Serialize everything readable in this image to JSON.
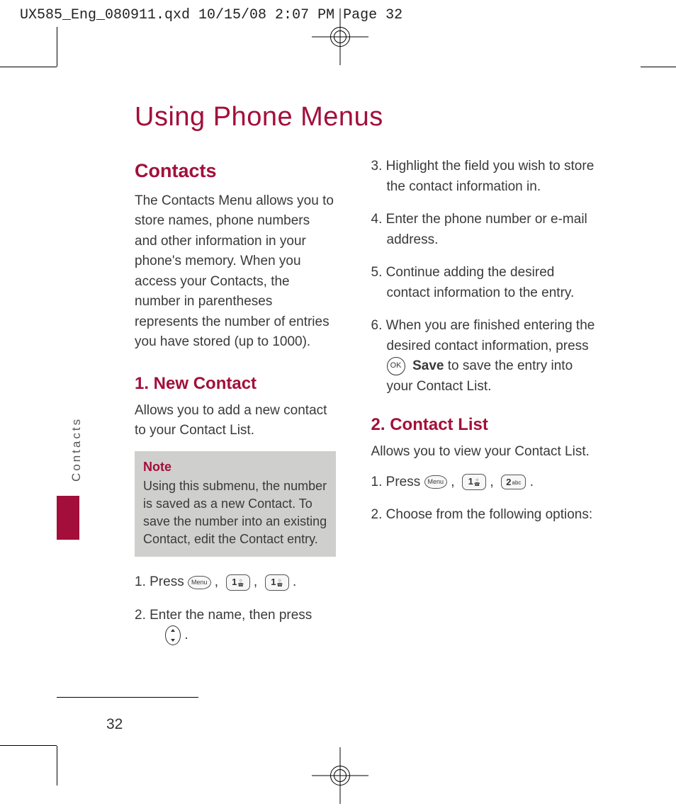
{
  "header_slug": "UX585_Eng_080911.qxd  10/15/08  2:07 PM  Page 32",
  "page_title": "Using Phone Menus",
  "side_tab": "Contacts",
  "page_number": "32",
  "section_contacts": {
    "heading": "Contacts",
    "body": "The Contacts Menu allows you to store names, phone numbers and other information in your phone's memory. When you access your Contacts, the number in parentheses represents the number of entries you have stored (up to 1000)."
  },
  "section_new_contact": {
    "heading": "1. New Contact",
    "intro": "Allows you to add a new contact to your Contact List.",
    "note_title": "Note",
    "note_body": "Using this submenu, the number is saved as a new Contact. To save the number into an existing Contact, edit the Contact entry.",
    "step1_lead": "1. Press ",
    "step2": "2. Enter the name, then press",
    "step3": "3. Highlight the field you wish to store the contact information in.",
    "step4": "4. Enter the phone number or e-mail address.",
    "step5": "5. Continue adding the desired contact information to the entry.",
    "step6_a": "6. When you are finished entering the desired contact information, press ",
    "step6_save": "Save",
    "step6_b": " to save the entry into your Contact List."
  },
  "section_contact_list": {
    "heading": "2. Contact List",
    "intro": "Allows you to view your Contact List.",
    "step1_lead": "1. Press ",
    "step2": "2. Choose from the following options:"
  },
  "keys": {
    "menu": "Menu",
    "one": "1",
    "two": "2",
    "two_sub": "abc",
    "ok": "OK"
  }
}
